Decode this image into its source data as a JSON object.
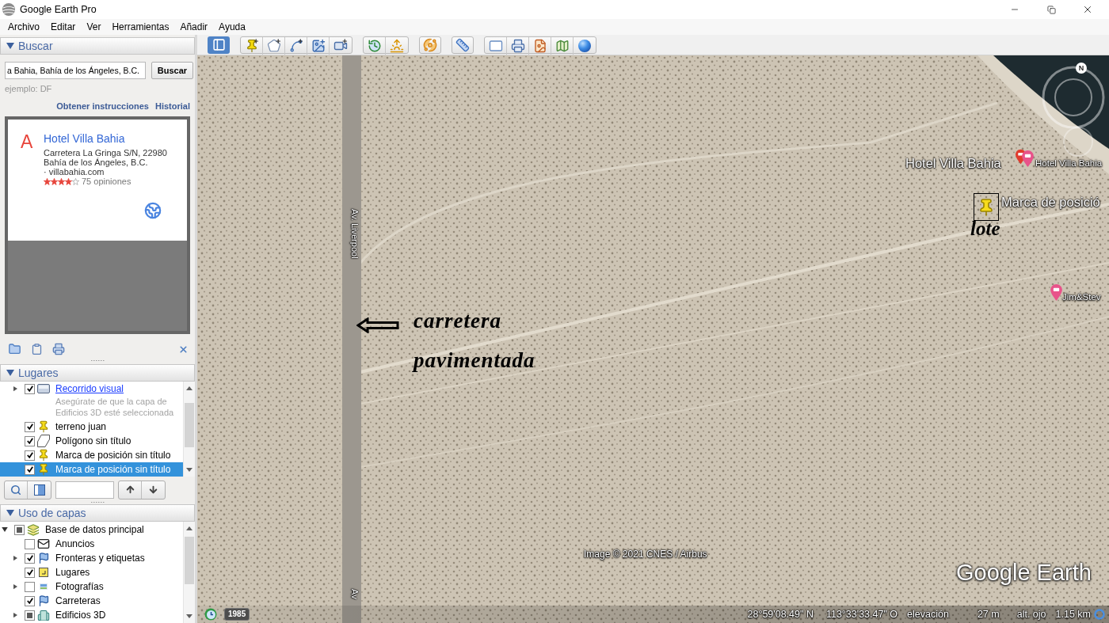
{
  "window": {
    "title": "Google Earth Pro"
  },
  "menu": [
    "Archivo",
    "Editar",
    "Ver",
    "Herramientas",
    "Añadir",
    "Ayuda"
  ],
  "search_panel": {
    "title": "Buscar",
    "expanded": true,
    "query": "a Bahia, Bahía de los Ángeles, B.C.",
    "button": "Buscar",
    "hint": "ejemplo: DF",
    "links": [
      "Obtener instrucciones",
      "Historial"
    ],
    "result": {
      "marker": "A",
      "name": "Hotel Villa Bahia",
      "address": [
        "Carretera La Gringa S/N, 22980",
        "Bahía de los Ángeles, B.C."
      ],
      "website": "· villabahia.com",
      "stars": 4,
      "reviews": "75 opiniones"
    }
  },
  "places_panel": {
    "title": "Lugares",
    "expanded": true,
    "items": [
      {
        "kind": "tour",
        "label": "Recorrido visual",
        "note": "Asegúrate de que la capa de Edificios 3D esté seleccionada",
        "checked": true,
        "expanded": false,
        "selected": false
      },
      {
        "kind": "placemark",
        "label": "terreno juan",
        "checked": true,
        "selected": false
      },
      {
        "kind": "polygon",
        "label": "Polígono sin título",
        "checked": true,
        "selected": false
      },
      {
        "kind": "placemark",
        "label": "Marca de posición sin título",
        "checked": true,
        "selected": false
      },
      {
        "kind": "placemark",
        "label": "Marca de posición sin título",
        "checked": true,
        "selected": true
      }
    ]
  },
  "layers_panel": {
    "title": "Uso de capas",
    "expanded": true,
    "items": [
      {
        "kind": "database",
        "label": "Base de datos principal",
        "checked": false,
        "mixed": true,
        "expanded": true,
        "children": [
          {
            "kind": "ads",
            "label": "Anuncios",
            "checked": false
          },
          {
            "kind": "borders",
            "label": "Fronteras y etiquetas",
            "checked": true,
            "expanded": false
          },
          {
            "kind": "places",
            "label": "Lugares",
            "checked": true
          },
          {
            "kind": "photos",
            "label": "Fotografías",
            "checked": false,
            "expanded": false
          },
          {
            "kind": "roads",
            "label": "Carreteras",
            "checked": true
          },
          {
            "kind": "buildings",
            "label": "Edificios 3D",
            "checked": false,
            "mixed": true,
            "expanded": false
          }
        ]
      }
    ]
  },
  "toolbar": {
    "sidebar_on": true
  },
  "map": {
    "road_labels": [
      "Av. Liverpool",
      "Av"
    ],
    "annotation": [
      "carretera",
      "pavimentada"
    ],
    "search_result": {
      "label": "Hotel Villa Bahia"
    },
    "pois": [
      {
        "label": "Hotel Villa Bahia"
      },
      {
        "label": "Jim&Stev"
      }
    ],
    "placemark": {
      "label": "Marca de posició",
      "note": "lote"
    },
    "compass": "N",
    "attribution": "Image © 2021 CNES / Airbus",
    "logo": "Google Earth",
    "historical_year": "1985",
    "status": {
      "latitude": "28°59'08.49\" N",
      "longitude": "113°33'33.47\" O",
      "elevation_label": "elevación",
      "elevation": "27 m",
      "eye_alt_label": "alt. ojo",
      "eye_alt": "1.15 km"
    }
  }
}
